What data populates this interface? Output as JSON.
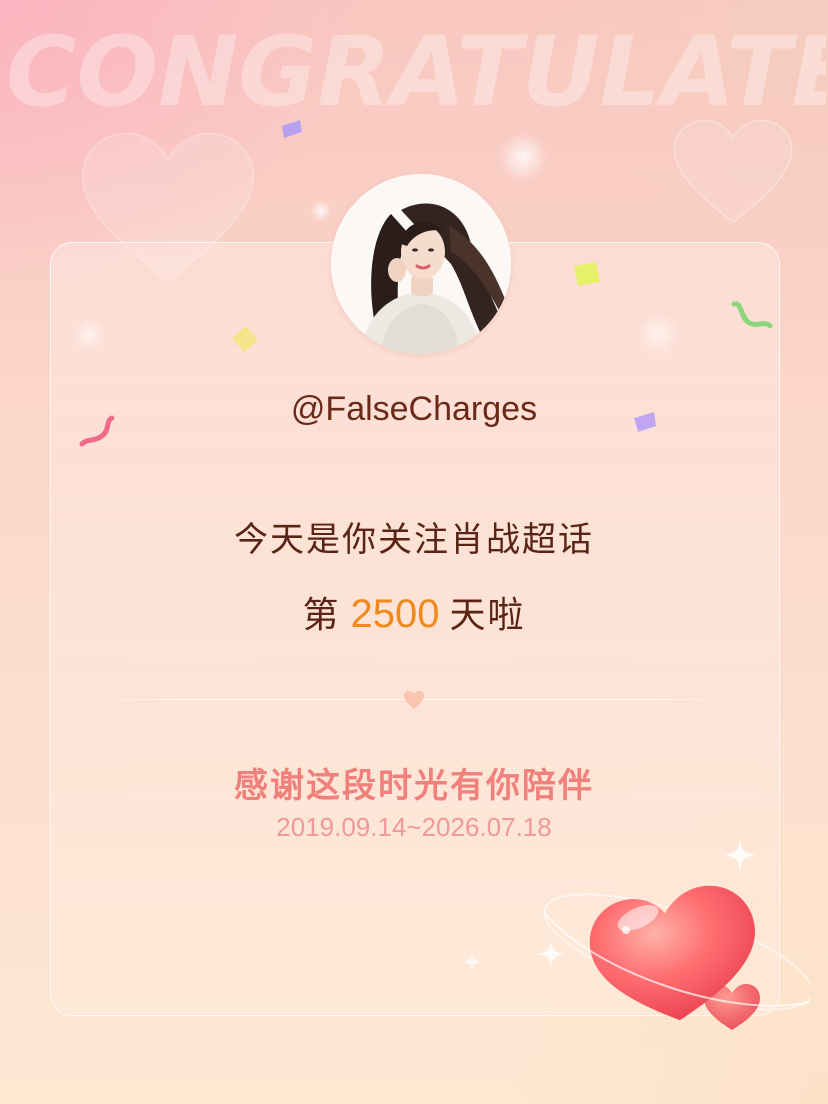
{
  "banner": {
    "text": "CONGRATULATE"
  },
  "profile": {
    "username": "@FalseCharges",
    "avatar_alt": "avatar"
  },
  "message": {
    "line1": "今天是你关注肖战超话",
    "line2_prefix": "第",
    "days": "2500",
    "line2_suffix": "天啦"
  },
  "footer": {
    "thanks": "感谢这段时光有你陪伴",
    "date_range": "2019.09.14~2026.07.18"
  },
  "colors": {
    "accent_number": "#f08a1c",
    "thanks_text": "#f0807c",
    "date_text": "#f0989a",
    "main_text": "#5a2414",
    "heart": "#f45a64"
  },
  "icons": {
    "big_heart": "heart-icon",
    "divider_heart": "small-heart-icon",
    "sparkles": "sparkle-icon",
    "confetti": "confetti-icon"
  }
}
